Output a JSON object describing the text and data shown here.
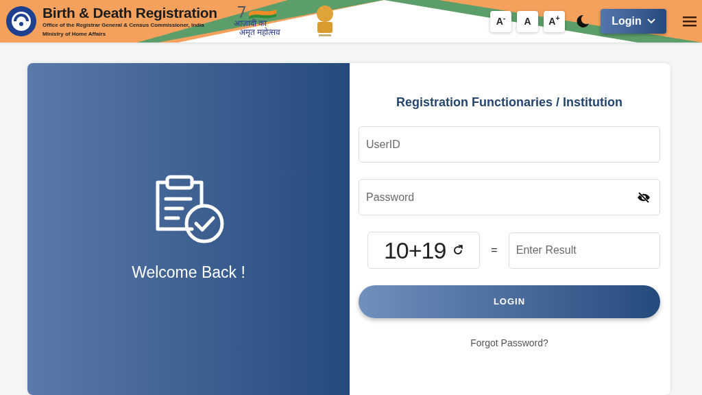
{
  "header": {
    "title": "Birth & Death Registration",
    "subtitle": "Office of the Registrar General & Census Commissioner, India",
    "ministry": "Ministry of Home Affairs",
    "azadi_lines": [
      "आज़ादी का",
      "अमृत महोत्सव"
    ]
  },
  "font_buttons": [
    "A$^{-}$",
    "A",
    "A$^{+}$"
  ],
  "login_menu": {
    "label": "Login"
  },
  "welcome": {
    "text": "Welcome Back !"
  },
  "form": {
    "heading": "Registration Functionaries / Institution",
    "userid": {
      "placeholder": "UserID"
    },
    "password": {
      "placeholder": "Password"
    },
    "captcha": "10+19",
    "equals": "=",
    "result": {
      "placeholder": "Enter Result"
    },
    "submit": "LOGIN",
    "forgot": "Forgot Password?"
  }
}
